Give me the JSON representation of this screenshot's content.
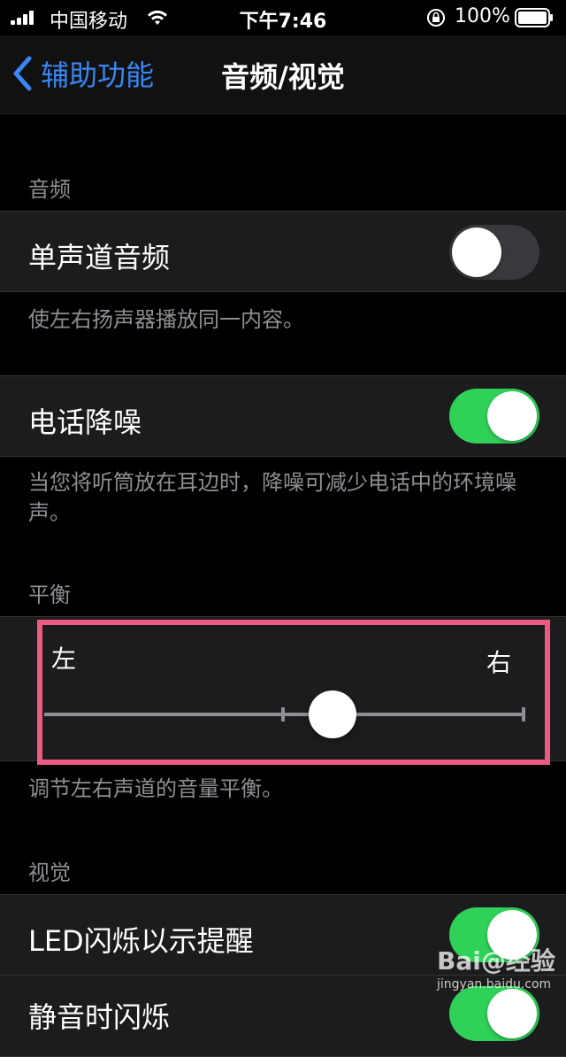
{
  "status": {
    "carrier": "中国移动",
    "time": "下午7:46",
    "battery": "100%"
  },
  "nav": {
    "back_label": "辅助功能",
    "title": "音频/视觉"
  },
  "audio": {
    "header": "音频",
    "mono_label": "单声道音频",
    "mono_on": false,
    "mono_footer": "使左右扬声器播放同一内容。",
    "noise_label": "电话降噪",
    "noise_on": true,
    "noise_footer": "当您将听筒放在耳边时，降噪可减少电话中的环境噪声。"
  },
  "balance": {
    "header": "平衡",
    "left": "左",
    "right": "右",
    "value": 0.2,
    "footer": "调节左右声道的音量平衡。"
  },
  "visual": {
    "header": "视觉",
    "led_label": "LED闪烁以示提醒",
    "led_on": true,
    "next_label": "静音时闪烁",
    "next_on": true
  },
  "watermark": {
    "main": "Bai@经验",
    "sub": "jingyan.baidu.com"
  },
  "colors": {
    "accent": "#3a86f5",
    "toggle_on": "#30d158",
    "toggle_off": "#39393d",
    "highlight": "#ec5a82"
  }
}
